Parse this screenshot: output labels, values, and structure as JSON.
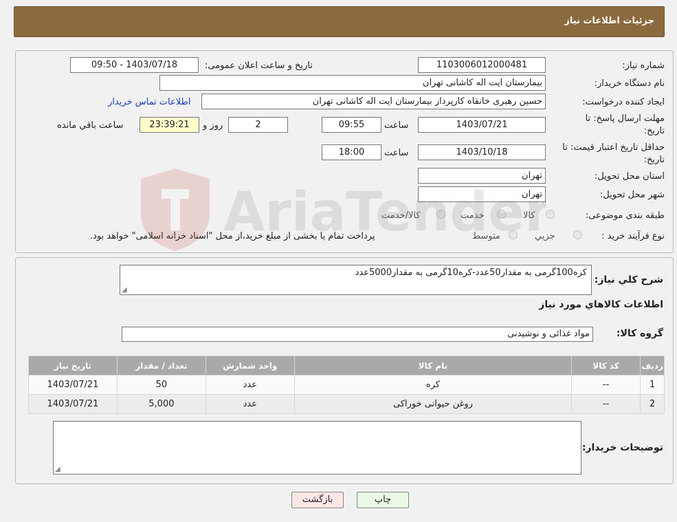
{
  "header": {
    "title": "جزئیات اطلاعات نیاز"
  },
  "info": {
    "need_number_label": "شماره نیاز:",
    "need_number": "1103006012000481",
    "announce_label": "تاریخ و ساعت اعلان عمومی:",
    "announce_value": "1403/07/18 - 09:50",
    "buyer_org_label": "نام دستگاه خریدار:",
    "buyer_org": "بیمارستان ایت اله کاشانی تهران",
    "creator_label": "ایجاد کننده درخواست:",
    "creator": "حسین رهبری خانقاه کارپرداز بیمارستان ایت اله کاشانی تهران",
    "contact_link": "اطلاعات تماس خریدار",
    "reply_deadline_label_1": "مهلت ارسال پاسخ: تا",
    "reply_deadline_label_2": "تاریخ:",
    "reply_date": "1403/07/21",
    "time_label": "ساعت",
    "reply_time": "09:55",
    "days_value": "2",
    "days_label": "روز و",
    "remaining_time": "23:39:21",
    "remaining_label": "ساعت باقي مانده",
    "price_validity_label_1": "حداقل تاریخ اعتبار قیمت: تا",
    "price_validity_label_2": "تاریخ:",
    "price_validity_date": "1403/10/18",
    "price_validity_time": "18:00",
    "province_label": "استان محل تحویل:",
    "province": "تهران",
    "city_label": "شهر محل تحویل:",
    "city": "تهران",
    "category_label": "طبقه بندی موضوعی:",
    "category_options": [
      "کالا",
      "خدمت",
      "کالا/خدمت"
    ],
    "process_label": "نوع فرآیند خرید :",
    "process_options": [
      "جزيي",
      "متوسط"
    ],
    "payment_note": "پرداخت تمام یا بخشی از مبلغ خرید،از محل \"اسناد خزانه اسلامی\" خواهد بود."
  },
  "items": {
    "description_label": "شرح كلي نياز:",
    "description": "کره100گرمی به مقدار50عدد-کره10گرمی به مقدار5000عدد",
    "section_title": "اطلاعات كالاهاي مورد نياز",
    "group_label": "گروه کالا:",
    "group_value": "مواد غذائی و نوشیدنی",
    "columns": [
      "رديف",
      "کد کالا",
      "نام کالا",
      "واحد شمارش",
      "تعداد / مقدار",
      "تاریخ نیاز"
    ],
    "rows": [
      [
        "1",
        "--",
        "کره",
        "عدد",
        "50",
        "1403/07/21"
      ],
      [
        "2",
        "--",
        "روغن حیوانی خوراکی",
        "عدد",
        "5,000",
        "1403/07/21"
      ]
    ],
    "buyer_notes_label": "توضیحات خریدار:",
    "buyer_notes": ""
  },
  "buttons": {
    "print": "چاپ",
    "back": "بازگشت"
  },
  "watermark": {
    "text": "AriaTender.neT"
  },
  "colors": {
    "header_bg": "#8c6a3f",
    "print_bg": "#eaf8e6",
    "back_bg": "#fde6e6",
    "link": "#1a3cbd"
  }
}
